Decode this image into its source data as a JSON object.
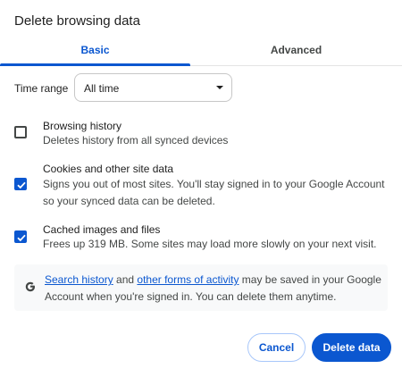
{
  "dialog": {
    "title": "Delete browsing data"
  },
  "tabs": [
    {
      "label": "Basic",
      "active": true
    },
    {
      "label": "Advanced",
      "active": false
    }
  ],
  "time_range": {
    "label": "Time range",
    "selected": "All time"
  },
  "options": [
    {
      "title": "Browsing history",
      "description": "Deletes history from all synced devices",
      "checked": false
    },
    {
      "title": "Cookies and other site data",
      "description": "Signs you out of most sites. You'll stay signed in to your Google Account so your synced data can be deleted.",
      "checked": true
    },
    {
      "title": "Cached images and files",
      "description": "Frees up 319 MB. Some sites may load more slowly on your next visit.",
      "checked": true
    }
  ],
  "info": {
    "icon": "google-g-icon",
    "link1": "Search history",
    "text1": " and ",
    "link2": "other forms of activity",
    "text2": " may be saved in your Google Account when you're signed in. You can delete them anytime."
  },
  "buttons": {
    "cancel": "Cancel",
    "delete": "Delete data"
  },
  "colors": {
    "accent": "#0b57d0",
    "info_background": "#f8f9fa"
  }
}
